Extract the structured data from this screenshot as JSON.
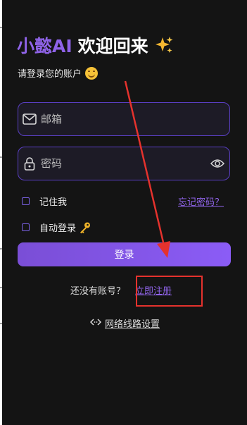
{
  "header": {
    "brand": "小懿AI",
    "welcome": "欢迎回来",
    "subtitle": "请登录您的账户"
  },
  "form": {
    "email_placeholder": "邮箱",
    "password_placeholder": "密码",
    "remember_label": "记住我",
    "auto_login_label": "自动登录",
    "forgot_label": "忘记密码？",
    "login_button": "登录"
  },
  "footer": {
    "no_account_text": "还没有账号？",
    "register_link": "立即注册",
    "network_label": "网络线路设置"
  },
  "colors": {
    "accent": "#8f63e8",
    "background": "#141414",
    "annotation": "#e5322d"
  },
  "icons": [
    "sparkle-icon",
    "smile-emoji-icon",
    "mail-icon",
    "lock-icon",
    "eye-icon",
    "key-icon",
    "network-arrows-icon"
  ]
}
